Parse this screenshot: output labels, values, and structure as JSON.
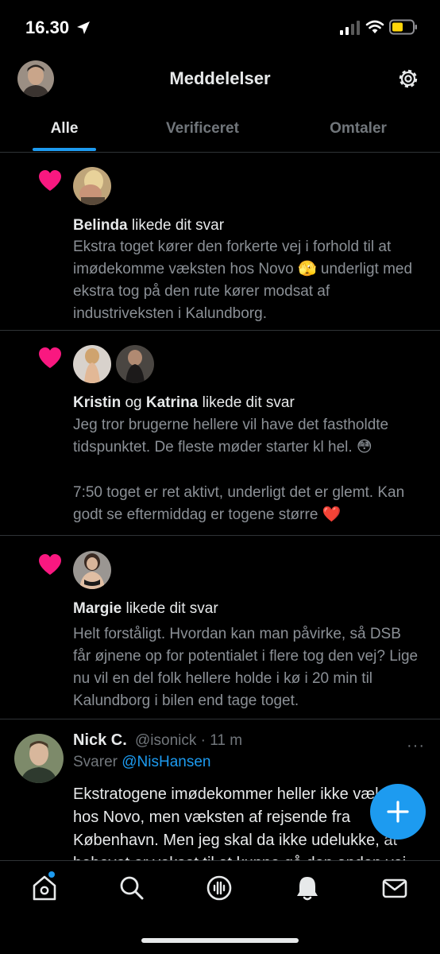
{
  "status_bar": {
    "time": "16.30"
  },
  "header": {
    "title": "Meddelelser"
  },
  "tabs": [
    {
      "label": "Alle"
    },
    {
      "label": "Verificeret"
    },
    {
      "label": "Omtaler"
    }
  ],
  "notifications": [
    {
      "actor1": "Belinda",
      "connector": "",
      "actor2": "",
      "action": " likede dit svar",
      "body": "Ekstra toget kører den forkerte vej i forhold til at imødekomme væksten hos Novo 🫣 underligt med ekstra tog på den rute kører modsat af industriveksten i Kalundborg."
    },
    {
      "actor1": "Kristin",
      "connector": " og ",
      "actor2": "Katrina",
      "action": " likede dit svar",
      "body_p1": "Jeg tror brugerne hellere vil have det fastholdte tidspunktet. De fleste møder starter kl hel. 😳",
      "body_p2": "7:50 toget er ret aktivt, underligt det er glemt. Kan godt se eftermiddag er togene større ❤️"
    },
    {
      "actor1": "Margie",
      "connector": "",
      "actor2": "",
      "action": " likede dit svar",
      "body": "Helt forståligt. Hvordan kan man påvirke, så DSB får øjnene op for potentialet i flere tog den vej? Lige nu vil en del folk hellere holde i kø i 20 min til Kalundborg i bilen end tage toget."
    }
  ],
  "tweet": {
    "name": "Nick C.",
    "handle": "@isonick",
    "separator": " · ",
    "time_ago": "11 m",
    "more": "···",
    "reply_prefix": "Svarer ",
    "reply_to": "@NisHansen",
    "text": "Ekstratogene imødekommer heller ikke væksten hos Novo, men væksten af rejsende fra København. Men jeg skal da ikke udelukke, at behovet er vokset til at kunne gå den anden vej."
  },
  "colors": {
    "accent": "#1d9bf0",
    "like": "#f91880",
    "background": "#000000",
    "divider": "#2f3336",
    "battery": "#ffd60a"
  },
  "icons": {
    "status": [
      "location-arrow-icon",
      "signal-icon",
      "wifi-icon",
      "battery-icon"
    ],
    "header": [
      "avatar",
      "gear-icon"
    ],
    "notification": "heart-icon",
    "fab": "plus-icon",
    "nav": [
      "home-icon",
      "search-icon",
      "spaces-icon",
      "bell-icon",
      "mail-icon"
    ]
  }
}
